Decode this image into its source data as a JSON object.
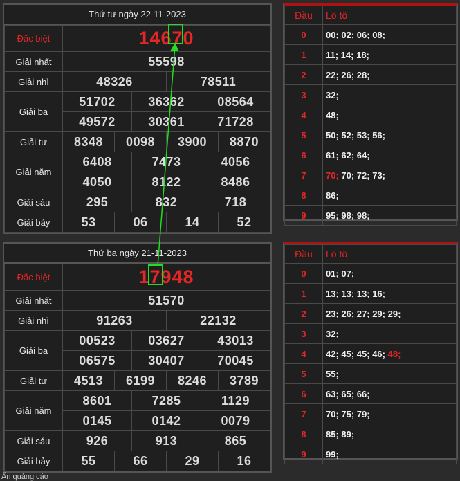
{
  "results": [
    {
      "date_title": "Thứ tư ngày 22-11-2023",
      "labels": {
        "db": "Đặc biệt",
        "g1": "Giải nhất",
        "g2": "Giải nhì",
        "g3": "Giải ba",
        "g4": "Giải tư",
        "g5": "Giải năm",
        "g6": "Giải sáu",
        "g7": "Giải bảy"
      },
      "db": "14670",
      "g1": "55598",
      "g2": [
        "48326",
        "78511"
      ],
      "g3": [
        "51702",
        "36362",
        "08564",
        "49572",
        "30361",
        "71728"
      ],
      "g4": [
        "8348",
        "0098",
        "3900",
        "8870"
      ],
      "g5": [
        "6408",
        "7473",
        "4056",
        "4050",
        "8122",
        "8486"
      ],
      "g6": [
        "295",
        "832",
        "718"
      ],
      "g7": [
        "53",
        "06",
        "14",
        "52"
      ]
    },
    {
      "date_title": "Thứ ba ngày 21-11-2023",
      "labels": {
        "db": "Đặc biệt",
        "g1": "Giải nhất",
        "g2": "Giải nhì",
        "g3": "Giải ba",
        "g4": "Giải tư",
        "g5": "Giải năm",
        "g6": "Giải sáu",
        "g7": "Giải bảy"
      },
      "db": "17948",
      "g1": "51570",
      "g2": [
        "91263",
        "22132"
      ],
      "g3": [
        "00523",
        "03627",
        "43013",
        "06575",
        "30407",
        "70045"
      ],
      "g4": [
        "4513",
        "6199",
        "8246",
        "3789"
      ],
      "g5": [
        "8601",
        "7285",
        "1129",
        "0145",
        "0142",
        "0079"
      ],
      "g6": [
        "926",
        "913",
        "865"
      ],
      "g7": [
        "55",
        "66",
        "29",
        "16"
      ]
    }
  ],
  "loto": [
    {
      "header_dau": "Đầu",
      "header_loto": "Lô tô",
      "rows": [
        {
          "dau": "0",
          "values": "00; 02; 06; 08;"
        },
        {
          "dau": "1",
          "values": "11; 14; 18;"
        },
        {
          "dau": "2",
          "values": "22; 26; 28;"
        },
        {
          "dau": "3",
          "values": "32;"
        },
        {
          "dau": "4",
          "values": "48;"
        },
        {
          "dau": "5",
          "values": "50; 52; 53; 56;"
        },
        {
          "dau": "6",
          "values": "61; 62; 64;"
        },
        {
          "dau": "7",
          "hl": "70;",
          "values": " 70; 72; 73;"
        },
        {
          "dau": "8",
          "values": "86;"
        },
        {
          "dau": "9",
          "values": "95; 98; 98;"
        }
      ]
    },
    {
      "header_dau": "Đầu",
      "header_loto": "Lô tô",
      "rows": [
        {
          "dau": "0",
          "values": "01; 07;"
        },
        {
          "dau": "1",
          "values": "13; 13; 13; 16;"
        },
        {
          "dau": "2",
          "values": "23; 26; 27; 29; 29;"
        },
        {
          "dau": "3",
          "values": "32;"
        },
        {
          "dau": "4",
          "values": "42; 45; 45; 46; ",
          "hl_after": "48;"
        },
        {
          "dau": "5",
          "values": "55;"
        },
        {
          "dau": "6",
          "values": "63; 65; 66;"
        },
        {
          "dau": "7",
          "values": "70; 75; 79;"
        },
        {
          "dau": "8",
          "values": "85; 89;"
        },
        {
          "dau": "9",
          "values": "99;"
        }
      ]
    }
  ],
  "footer_text": "Ẩn quảng cáo",
  "annotation": {
    "color": "#22dd22"
  }
}
